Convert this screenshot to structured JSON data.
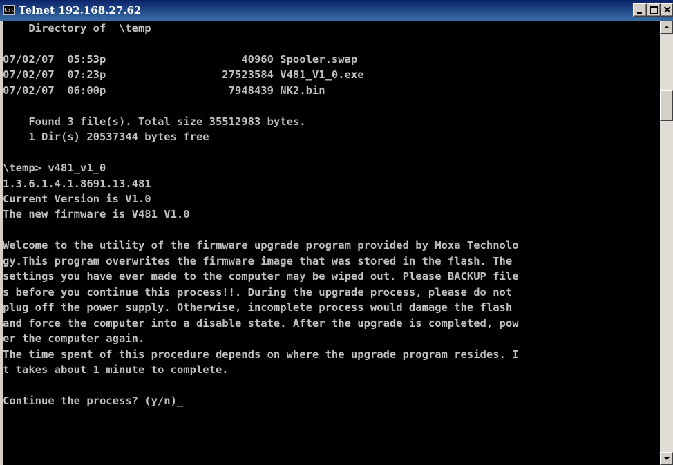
{
  "window": {
    "title": "Telnet 192.168.27.62",
    "icon": "console-icon",
    "icon_glyph": "C:\\"
  },
  "console": {
    "text": "    Directory of  \\temp\n\n07/02/07  05:53p                     40960 Spooler.swap\n07/02/07  07:23p                  27523584 V481_V1_0.exe\n07/02/07  06:00p                   7948439 NK2.bin\n\n    Found 3 file(s). Total size 35512983 bytes.\n    1 Dir(s) 20537344 bytes free\n\n\\temp> v481_v1_0\n1.3.6.1.4.1.8691.13.481\nCurrent Version is V1.0\nThe new firmware is V481 V1.0\n\nWelcome to the utility of the firmware upgrade program provided by Moxa Technolo\ngy.This program overwrites the firmware image that was stored in the flash. The\nsettings you have ever made to the computer may be wiped out. Please BACKUP file\ns before you continue this process!!. During the upgrade process, please do not\nplug off the power supply. Otherwise, incomplete process would damage the flash\nand force the computer into a disable state. After the upgrade is completed, pow\ner the computer again.\nThe time spent of this procedure depends on where the upgrade program resides. I\nt takes about 1 minute to complete.\n\nContinue the process? (y/n)",
    "cursor": "_"
  },
  "icons": {
    "minimize": "minimize-icon",
    "maximize": "maximize-icon",
    "close": "close-icon",
    "scroll_up": "scroll-up-arrow-icon",
    "scroll_down": "scroll-down-arrow-icon"
  },
  "colors": {
    "title_gradient_start": "#0a246a",
    "title_gradient_end": "#3a6ea5",
    "console_bg": "#000000",
    "console_fg": "#c0c0c0"
  }
}
